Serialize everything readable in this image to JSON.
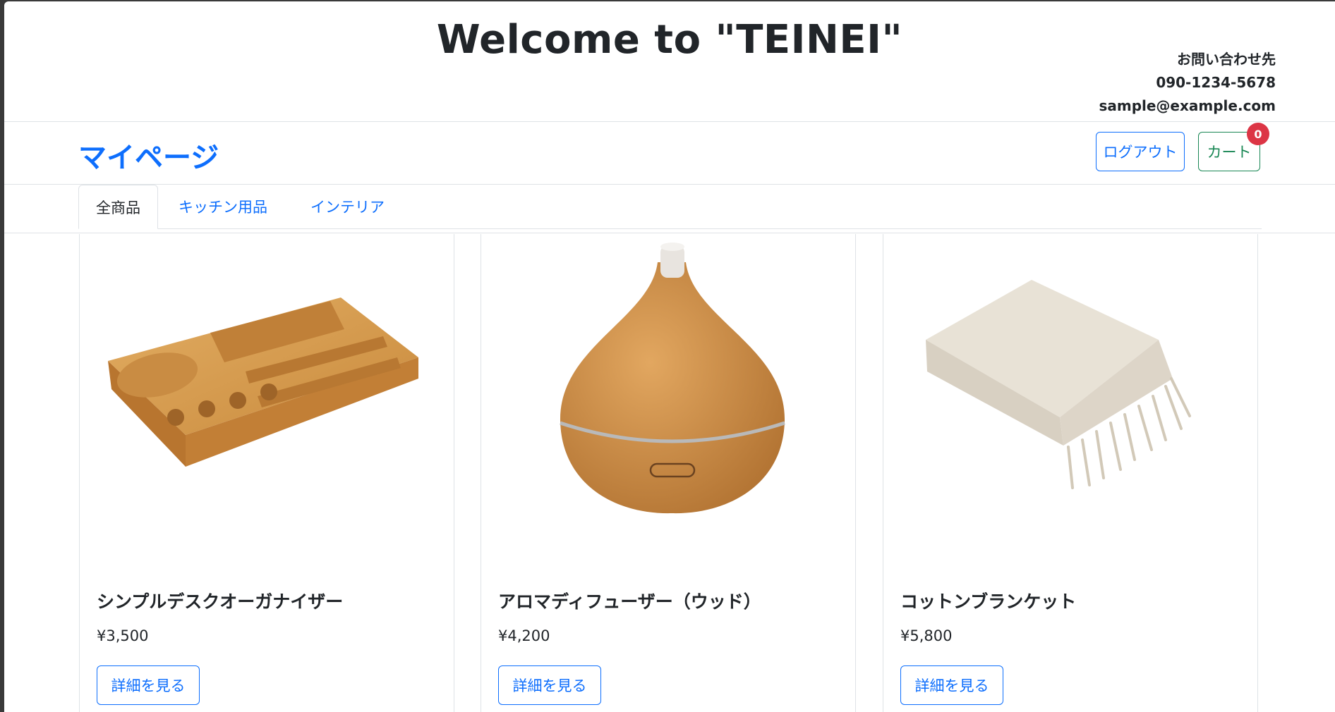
{
  "header": {
    "title": "Welcome to \"TEINEI\"",
    "contact_heading": "お問い合わせ先",
    "phone": "090-1234-5678",
    "email": "sample@example.com"
  },
  "nav": {
    "brand": "マイページ",
    "logout_label": "ログアウト",
    "cart_label": "カート",
    "cart_count": "0"
  },
  "tabs": [
    {
      "label": "全商品",
      "active": true
    },
    {
      "label": "キッチン用品",
      "active": false
    },
    {
      "label": "インテリア",
      "active": false
    }
  ],
  "products": [
    {
      "name": "シンプルデスクオーガナイザー",
      "price": "¥3,500",
      "button": "詳細を見る",
      "image": "bamboo-desk-organizer"
    },
    {
      "name": "アロマディフューザー（ウッド）",
      "price": "¥4,200",
      "button": "詳細を見る",
      "image": "wood-aroma-diffuser"
    },
    {
      "name": "コットンブランケット",
      "price": "¥5,800",
      "button": "詳細を見る",
      "image": "cotton-blanket"
    }
  ],
  "colors": {
    "primary": "#0d6efd",
    "success": "#198754",
    "danger": "#dc3545",
    "border": "#dee2e6",
    "text": "#212529"
  }
}
